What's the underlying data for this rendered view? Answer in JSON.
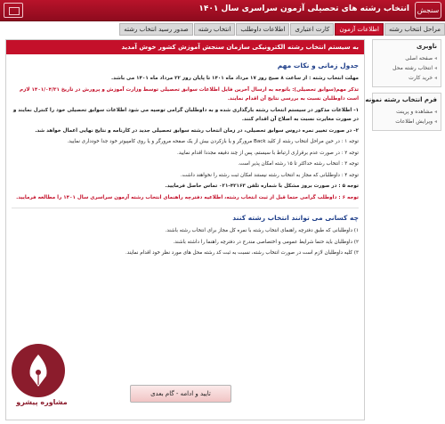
{
  "header": {
    "title": "انتخاب رشته های تحصیلی آزمون سراسری سال ۱۴۰۱",
    "logo_text": "سنجش"
  },
  "tabs": [
    {
      "label": "مراحل انتخاب رشته"
    },
    {
      "label": "اطلاعات آزمون"
    },
    {
      "label": "کارت اعتباری"
    },
    {
      "label": "اطلاعات داوطلب"
    },
    {
      "label": "انتخاب رشته"
    },
    {
      "label": "صدور رسید انتخاب رشته"
    }
  ],
  "sidebar": {
    "nav_title": "ناوبری",
    "nav_items": [
      "صفحه اصلی",
      "انتخاب رشته محل",
      "خرید کارت"
    ],
    "form_title": "فرم انتخاب رشته نمونه ام",
    "form_items": [
      "مشاهده و پرینت",
      "ویرایش اطلاعات"
    ]
  },
  "main": {
    "banner": "به سیستم انتخاب رشته الکترونیکی سازمان سنجش آموزش کشور خوش آمدید",
    "section1_title": "جدول زمانی و نکات مهم",
    "deadline": "مهلت انتخاب رشته : از ساعت ۸ صبح روز ۱۷ مرداد ماه ۱۴۰۱ تا پایان روز ۲۲ مرداد ماه ۱۴۰۱ می باشد.",
    "warning": "تذکر مهم(سوابق تحصیلی): باتوجه به ارسال آخرین فایل اطلاعات سوابق تحصیلی توسط وزارت آموزش و پرورش در تاریخ ۱۴۰۱/۰۴/۳۱ لازم است داوطلبان نسبت به بررسی نتایج آن اقدام نمایند.",
    "note1": "۱- اطلاعات مذکور در سیستم انتخاب رشته بارگذاری شده و به داوطلبان گرامی توصیه می شود اطلاعات سوابق تحصیلی خود را کنترل نمایند و در صورت مغایرت نسبت به اصلاح آن اقدام کنند.",
    "note2": "۲- در صورت تغییر نمره دروس سوابق تحصیلی، در زمان انتخاب رشته سوابق تحصیلی جدید در کارنامه و نتایج نهایی اعمال خواهد شد.",
    "tip1": "توجه ۱ : در حین مراحل انتخاب رشته از کلید Back مرورگر و یا بازکردن بیش از یک صفحه مرورگر و یا روی کامپیوتر خود جدا خودداری نمایید.",
    "tip2": "توجه ۲ : در صورت عدم برقراری ارتباط با سیستم، پس از چند دقیقه مجددا اقدام نمایید.",
    "tip3": "توجه ۳ : انتخاب رشته حداکثر تا ۱۵ رشته امکان پذیر است.",
    "tip4": "توجه ۴ : داوطلبانی که مجاز به انتخاب رشته نیستند امکان ثبت رشته را نخواهند داشت.",
    "tip5": "توجه ۵ : در صورت بروز مشکل با شماره تلفن ۴۲۱۶۳-۰۲۱ تماس حاصل فرمایید.",
    "tip6": "توجه ۶ : داوطلب گرامی حتما قبل از ثبت انتخاب رشته، اطلاعیه دفترچه راهنمای انتخاب رشته آزمون سراسری سال ۱۴۰۱ را مطالعه فرمایید.",
    "section2_title": "چه کسانی می توانند انتخاب رشته کنند",
    "item1": "۱) داوطلبانی که طبق دفترچه راهنمای انتخاب رشته با نمره کل مجاز برای انتخاب رشته باشند.",
    "item2": "۲) داوطلبان باید حتما شرایط عمومی و اختصاصی مندرج در دفترچه راهنما را داشته باشند.",
    "item3": "۳) کلیه داوطلبان لازم است در صورت انتخاب رشته، نسبت به ثبت کد رشته محل های مورد نظر خود اقدام نمایند.",
    "next_button": "تایید و ادامه - گام بعدی"
  },
  "logo_badge": {
    "text": "مشاوره پیشرو"
  },
  "colors": {
    "brand_red": "#c4102a",
    "link_blue": "#1f3f8a"
  }
}
